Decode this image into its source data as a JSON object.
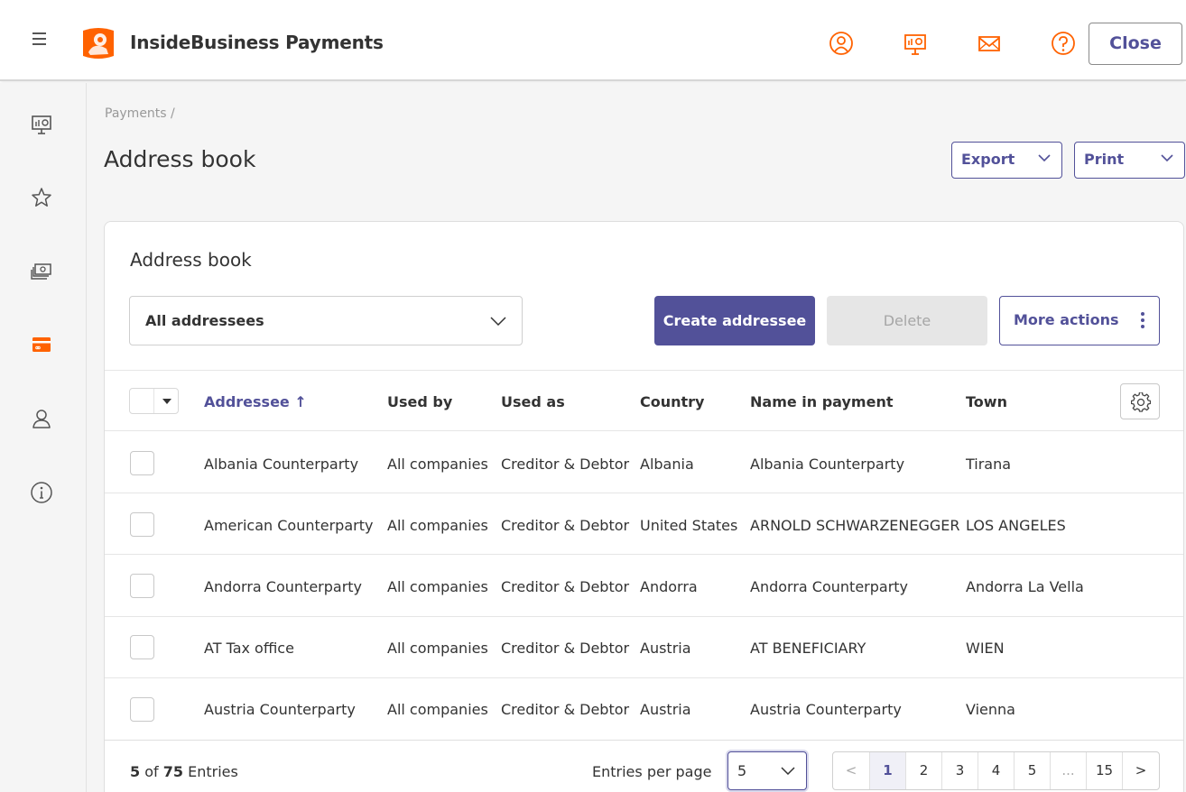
{
  "app": {
    "title": "InsideBusiness Payments",
    "close_label": "Close"
  },
  "top_icons": [
    "user-circle-icon",
    "presentation-chart-icon",
    "envelope-icon",
    "help-icon"
  ],
  "sidebar_icons": [
    "presentation-chart-icon",
    "star-icon",
    "cash-stack-icon",
    "card-icon",
    "person-icon",
    "info-icon"
  ],
  "breadcrumb": "Payments /",
  "page_title": "Address book",
  "header_buttons": {
    "export": "Export",
    "print": "Print"
  },
  "card": {
    "title": "Address book",
    "filter_value": "All addressees",
    "create_label": "Create addressee",
    "delete_label": "Delete",
    "more_label": "More actions"
  },
  "table": {
    "columns": [
      "Addressee ↑",
      "Used by",
      "Used as",
      "Country",
      "Name in payment",
      "Town"
    ],
    "rows": [
      [
        "Albania Counterparty",
        "All companies",
        "Creditor & Debtor",
        "Albania",
        "Albania Counterparty",
        "Tirana"
      ],
      [
        "American Counterparty",
        "All companies",
        "Creditor & Debtor",
        "United States",
        "ARNOLD SCHWARZENEGGER",
        "LOS ANGELES"
      ],
      [
        "Andorra Counterparty",
        "All companies",
        "Creditor & Debtor",
        "Andorra",
        "Andorra Counterparty",
        "Andorra La Vella"
      ],
      [
        "AT Tax office",
        "All companies",
        "Creditor & Debtor",
        "Austria",
        "AT BENEFICIARY",
        "WIEN"
      ],
      [
        "Austria Counterparty",
        "All companies",
        "Creditor & Debtor",
        "Austria",
        "Austria Counterparty",
        "Vienna"
      ]
    ]
  },
  "footer": {
    "shown": "5",
    "of": "of",
    "total": "75",
    "entries": "Entries",
    "per_page_label": "Entries per page",
    "per_page_value": "5",
    "pages": [
      "<",
      "1",
      "2",
      "3",
      "4",
      "5",
      "...",
      "15",
      ">"
    ]
  },
  "colors": {
    "accent": "#525199",
    "brand_orange": "#FF6200",
    "background": "#F5F5F5"
  }
}
